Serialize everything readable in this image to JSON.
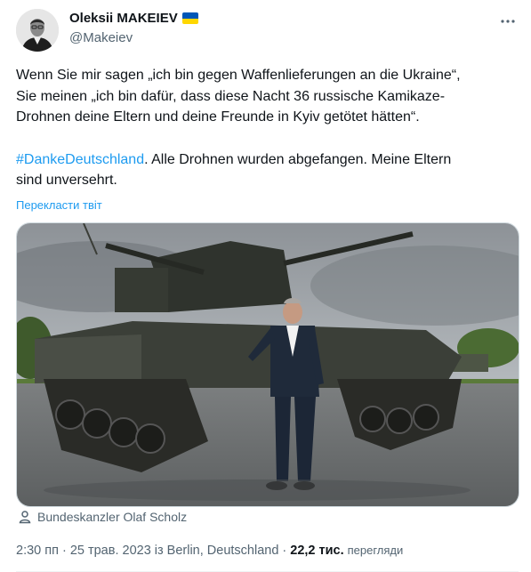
{
  "author": {
    "display_name": "Oleksii MAKEIEV",
    "handle": "@Makeiev",
    "flag_icon": "ukraine-flag-icon"
  },
  "tweet": {
    "text_line1": "Wenn Sie mir sagen „ich bin gegen Waffenlieferungen an die Ukraine“,",
    "text_line2": "Sie meinen „ich bin dafür, dass diese Nacht 36 russische Kamikaze-",
    "text_line3": "Drohnen deine Eltern und deine Freunde in Kyiv getötet hätten“.",
    "hashtag": "#DankeDeutschland",
    "text_after_hashtag": ". Alle Drohnen wurden abgefangen. Meine Eltern",
    "text_line5": "sind unversehrt.",
    "translate_label": "Перекласти твіт"
  },
  "media": {
    "caption": "Bundeskanzler Olaf Scholz"
  },
  "meta": {
    "time": "2:30 пп",
    "separator": "·",
    "date": "25 трав. 2023",
    "location": "із Berlin, Deutschland",
    "views_count": "22,2 тис.",
    "views_label": "перегляди"
  },
  "colors": {
    "link": "#1d9bf0",
    "secondary_text": "#536471",
    "flag_blue": "#0057b7",
    "flag_yellow": "#ffd700"
  }
}
